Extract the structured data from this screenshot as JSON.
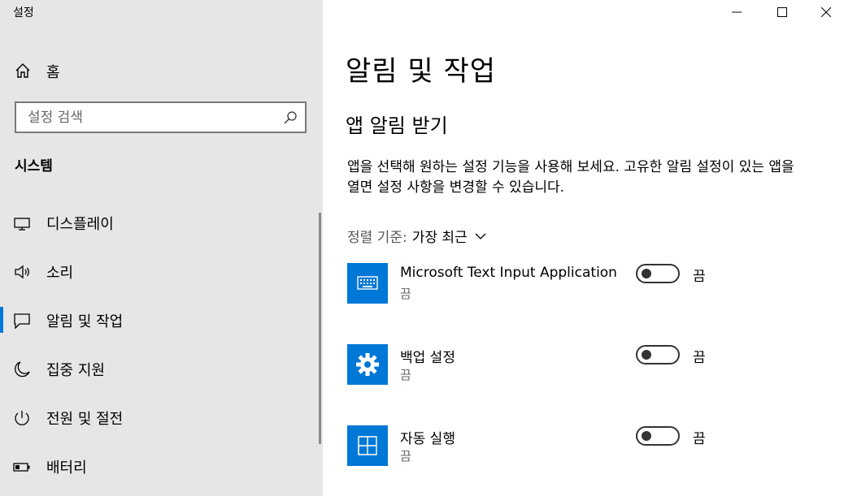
{
  "window": {
    "title": "설정"
  },
  "sidebar": {
    "home_label": "홈",
    "search_placeholder": "설정 검색",
    "section_label": "시스템",
    "items": [
      {
        "label": "디스플레이",
        "icon": "monitor-icon",
        "selected": false
      },
      {
        "label": "소리",
        "icon": "speaker-icon",
        "selected": false
      },
      {
        "label": "알림 및 작업",
        "icon": "notification-icon",
        "selected": true
      },
      {
        "label": "집중 지원",
        "icon": "moon-icon",
        "selected": false
      },
      {
        "label": "전원 및 절전",
        "icon": "power-icon",
        "selected": false
      },
      {
        "label": "배터리",
        "icon": "battery-icon",
        "selected": false
      }
    ]
  },
  "main": {
    "title": "알림 및 작업",
    "subtitle": "앱 알림 받기",
    "description": "앱을 선택해 원하는 설정 기능을 사용해 보세요. 고유한 알림 설정이 있는 앱을 열면 설정 사항을 변경할 수 있습니다.",
    "sort_key": "정렬 기준:",
    "sort_value": "가장 최근",
    "apps": [
      {
        "name": "Microsoft Text Input Application",
        "state": "끔",
        "toggle_label": "끔",
        "on": false,
        "icon": "keyboard-icon"
      },
      {
        "name": "백업 설정",
        "state": "끔",
        "toggle_label": "끔",
        "on": false,
        "icon": "gear-icon"
      },
      {
        "name": "자동 실행",
        "state": "끔",
        "toggle_label": "끔",
        "on": false,
        "icon": "autoplay-icon"
      }
    ]
  },
  "colors": {
    "accent": "#0078d7",
    "sidebar_bg": "#e6e6e6"
  }
}
